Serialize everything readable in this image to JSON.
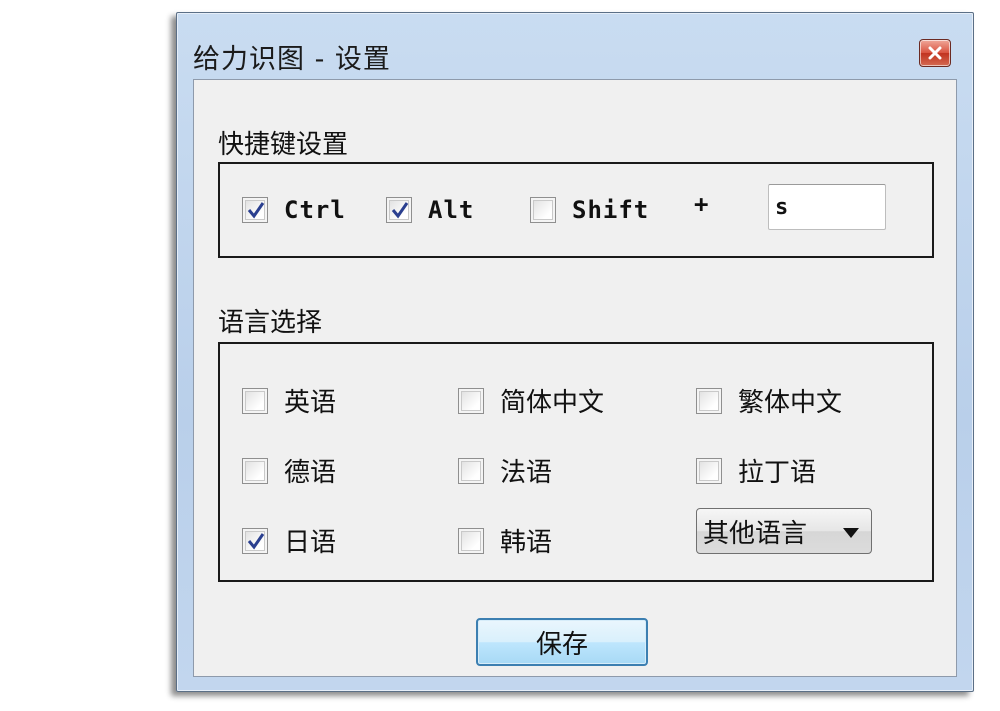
{
  "window": {
    "title": "给力识图 - 设置"
  },
  "hotkey": {
    "section_label": "快捷键设置",
    "ctrl": {
      "label": "Ctrl",
      "checked": true
    },
    "alt": {
      "label": "Alt",
      "checked": true
    },
    "shift": {
      "label": "Shift",
      "checked": false
    },
    "plus": "+",
    "key_value": "s"
  },
  "language": {
    "section_label": "语言选择",
    "options": [
      {
        "label": "英语",
        "checked": false
      },
      {
        "label": "简体中文",
        "checked": false
      },
      {
        "label": "繁体中文",
        "checked": false
      },
      {
        "label": "德语",
        "checked": false
      },
      {
        "label": "法语",
        "checked": false
      },
      {
        "label": "拉丁语",
        "checked": false
      },
      {
        "label": "日语",
        "checked": true
      },
      {
        "label": "韩语",
        "checked": false
      }
    ],
    "other_dropdown": {
      "selected": "其他语言"
    }
  },
  "save_label": "保存",
  "icons": {
    "close": "close-icon",
    "check": "checkmark-icon",
    "dropdown_arrow": "triangle-down-icon"
  },
  "colors": {
    "titlebar": "#c2d6ee",
    "client_bg": "#f0f0f0",
    "close_red": "#c1331f",
    "check_blue": "#2a3f8f",
    "save_button_border": "#3c7fb1"
  }
}
